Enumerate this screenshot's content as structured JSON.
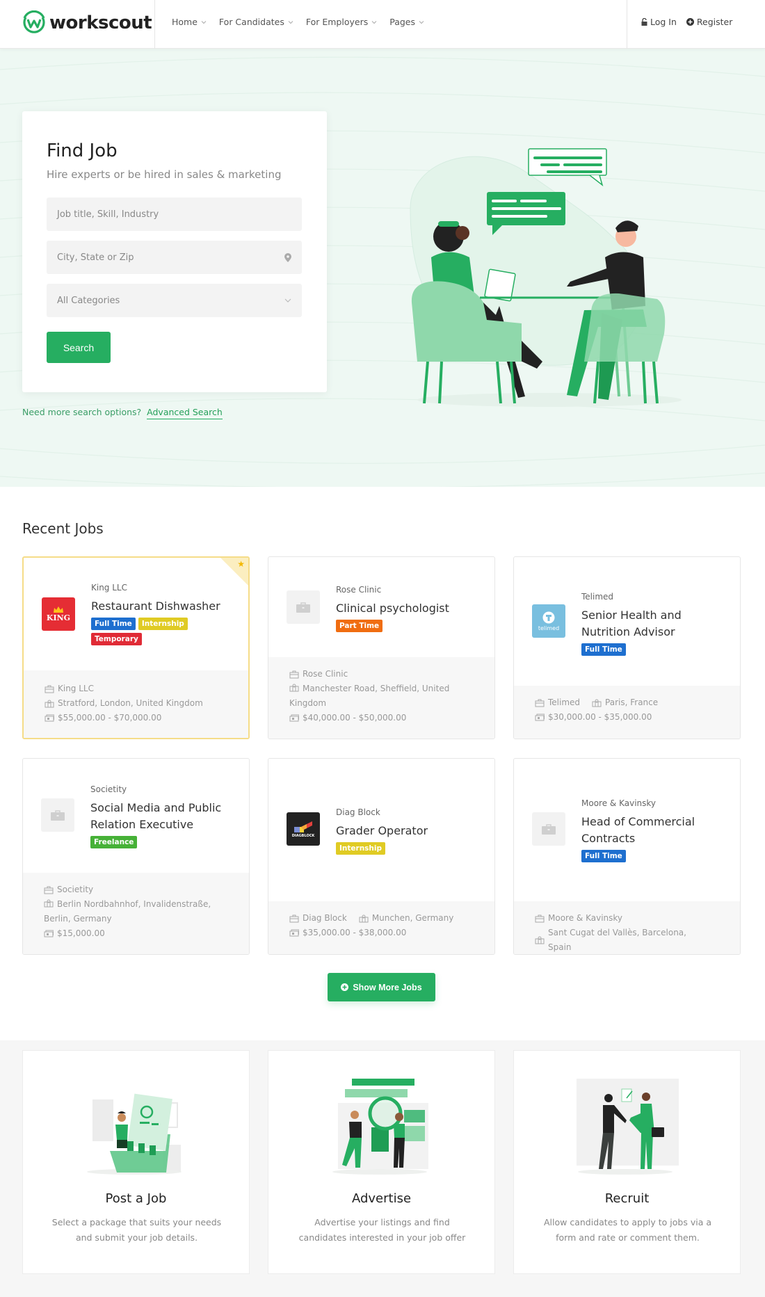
{
  "header": {
    "brand": "workscout",
    "nav": [
      {
        "label": "Home"
      },
      {
        "label": "For Candidates"
      },
      {
        "label": "For Employers"
      },
      {
        "label": "Pages"
      }
    ],
    "login_label": "Log In",
    "register_label": "Register"
  },
  "hero": {
    "title": "Find Job",
    "subtitle": "Hire experts or be hired in sales & marketing",
    "keyword_placeholder": "Job title, Skill, Industry",
    "location_placeholder": "City, State or Zip",
    "category_selected": "All Categories",
    "search_label": "Search",
    "advanced_prompt": "Need more search options?",
    "advanced_link": "Advanced Search"
  },
  "recent_jobs": {
    "title": "Recent Jobs",
    "jobs": [
      {
        "company": "King LLC",
        "title": "Restaurant Dishwasher",
        "tags": [
          "Full Time",
          "Internship",
          "Temporary"
        ],
        "location": "Stratford, London, United Kingdom",
        "salary": "$55,000.00 - $70,000.00",
        "featured": true,
        "logo": "KING"
      },
      {
        "company": "Rose Clinic",
        "title": "Clinical psychologist",
        "tags": [
          "Part Time"
        ],
        "location": "Manchester Road, Sheffield, United Kingdom",
        "salary": "$40,000.00 - $50,000.00",
        "featured": false,
        "logo": ""
      },
      {
        "company": "Telimed",
        "title": "Senior Health and Nutrition Advisor",
        "tags": [
          "Full Time"
        ],
        "location": "Paris, France",
        "salary": "$30,000.00 - $35,000.00",
        "featured": false,
        "logo": "telimed"
      },
      {
        "company": "Societity",
        "title": "Social Media and Public Relation Executive",
        "tags": [
          "Freelance"
        ],
        "location": "Berlin Nordbahnhof, Invalidenstraße, Berlin, Germany",
        "salary": "$15,000.00",
        "featured": false,
        "logo": ""
      },
      {
        "company": "Diag Block",
        "title": "Grader Operator",
        "tags": [
          "Internship"
        ],
        "location": "Munchen, Germany",
        "salary": "$35,000.00 - $38,000.00",
        "featured": false,
        "logo": "DIAGBLOCK"
      },
      {
        "company": "Moore & Kavinsky",
        "title": "Head of Commercial Contracts",
        "tags": [
          "Full Time"
        ],
        "location": "Sant Cugat del Vallès, Barcelona, Spain",
        "salary": "",
        "featured": false,
        "logo": ""
      }
    ],
    "show_more_label": "Show More Jobs"
  },
  "tag_colors": {
    "Full Time": "#1e6fcf",
    "Internship": "#e0cb24",
    "Temporary": "#e02b36",
    "Part Time": "#f06d11",
    "Freelance": "#46b137"
  },
  "features": [
    {
      "title": "Post a Job",
      "desc": "Select a package that suits your needs and submit your job details."
    },
    {
      "title": "Advertise",
      "desc": "Advertise your listings and find candidates interested in your job offer"
    },
    {
      "title": "Recruit",
      "desc": "Allow candidates to apply to jobs via a form and rate or comment them."
    }
  ],
  "colors": {
    "brand_green": "#26ae61",
    "hero_bg": "#eef8f3"
  }
}
